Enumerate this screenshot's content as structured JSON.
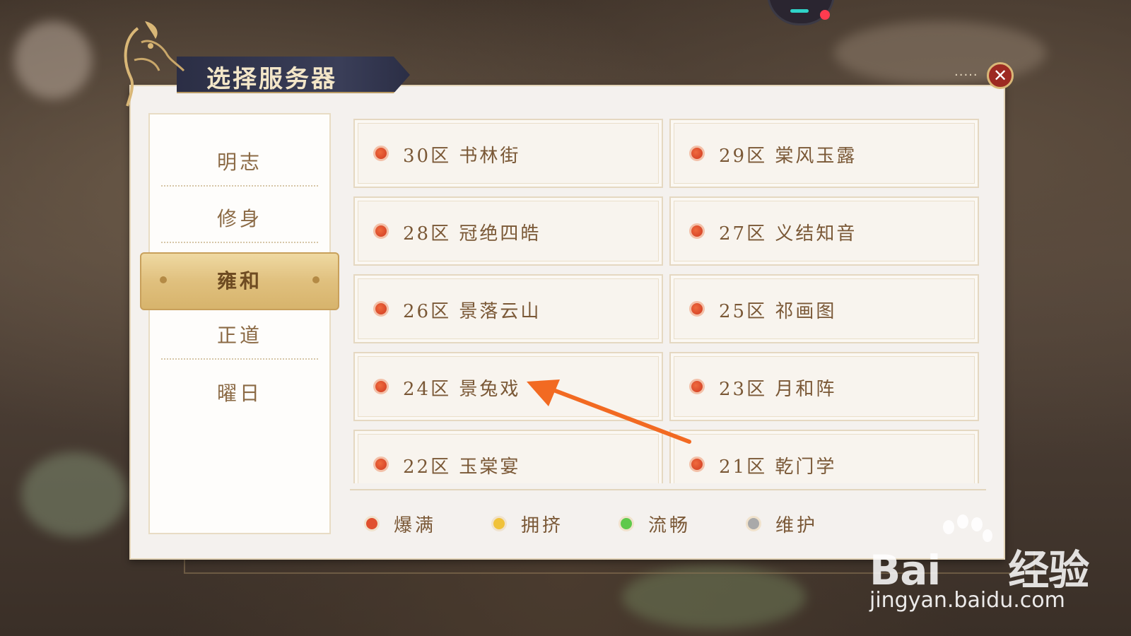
{
  "dialog": {
    "title": "选择服务器",
    "close_icon": "close-icon"
  },
  "categories": [
    {
      "label": "明志",
      "active": false
    },
    {
      "label": "修身",
      "active": false
    },
    {
      "label": "雍和",
      "active": true
    },
    {
      "label": "正道",
      "active": false
    },
    {
      "label": "曜日",
      "active": false
    }
  ],
  "servers": [
    {
      "label": "30区 书林街",
      "status": "爆满"
    },
    {
      "label": "29区 棠风玉露",
      "status": "爆满"
    },
    {
      "label": "28区 冠绝四皓",
      "status": "爆满"
    },
    {
      "label": "27区 义结知音",
      "status": "爆满"
    },
    {
      "label": "26区 景落云山",
      "status": "爆满"
    },
    {
      "label": "25区 祁画图",
      "status": "爆满"
    },
    {
      "label": "24区 景兔戏",
      "status": "爆满"
    },
    {
      "label": "23区 月和阵",
      "status": "爆满"
    },
    {
      "label": "22区 玉棠宴",
      "status": "爆满"
    },
    {
      "label": "21区 乾门学",
      "status": "爆满"
    }
  ],
  "legend": [
    {
      "label": "爆满",
      "color": "#e0502e"
    },
    {
      "label": "拥挤",
      "color": "#f0c23a"
    },
    {
      "label": "流畅",
      "color": "#5fc94b"
    },
    {
      "label": "维护",
      "color": "#a9a9a9"
    }
  ],
  "watermark": {
    "logo": "Bai",
    "logo_suffix": "经验",
    "url": "jingyan.baidu.com"
  }
}
